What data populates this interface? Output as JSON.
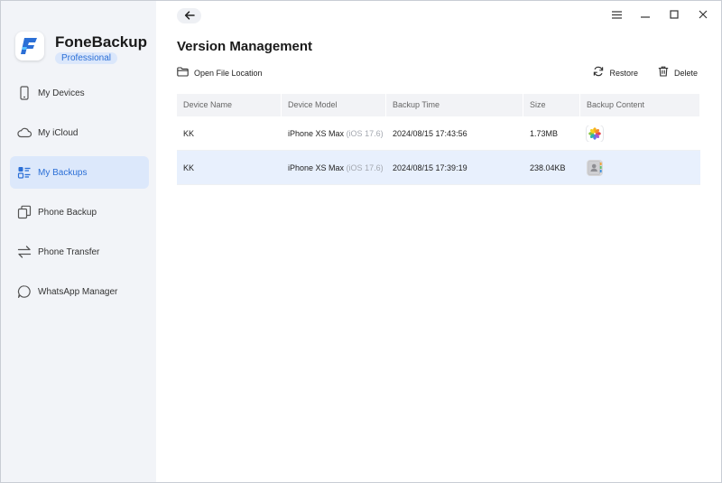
{
  "app": {
    "name": "FoneBackup",
    "edition": "Professional"
  },
  "sidebar": {
    "items": [
      {
        "label": "My Devices",
        "icon": "phone-icon",
        "active": false
      },
      {
        "label": "My iCloud",
        "icon": "cloud-icon",
        "active": false
      },
      {
        "label": "My Backups",
        "icon": "backups-icon",
        "active": true
      },
      {
        "label": "Phone Backup",
        "icon": "copy-icon",
        "active": false
      },
      {
        "label": "Phone Transfer",
        "icon": "transfer-icon",
        "active": false
      },
      {
        "label": "WhatsApp Manager",
        "icon": "chat-icon",
        "active": false
      }
    ]
  },
  "header": {
    "title": "Version Management"
  },
  "toolbar": {
    "open_location": "Open File Location",
    "restore": "Restore",
    "delete": "Delete"
  },
  "table": {
    "columns": [
      "Device Name",
      "Device Model",
      "Backup Time",
      "Size",
      "Backup Content"
    ],
    "rows": [
      {
        "name": "KK",
        "model": "iPhone XS Max",
        "os": "(iOS 17.6)",
        "time": "2024/08/15 17:43:56",
        "size": "1.73MB",
        "content_icon": "photos-icon",
        "selected": false
      },
      {
        "name": "KK",
        "model": "iPhone XS Max",
        "os": "(iOS 17.6)",
        "time": "2024/08/15 17:39:19",
        "size": "238.04KB",
        "content_icon": "contacts-icon",
        "selected": true
      }
    ]
  },
  "colors": {
    "accent": "#2b6fd6",
    "sidebar_bg": "#f2f4f8",
    "active_bg": "#dce8fb",
    "selected_row": "#e8f0fd"
  }
}
